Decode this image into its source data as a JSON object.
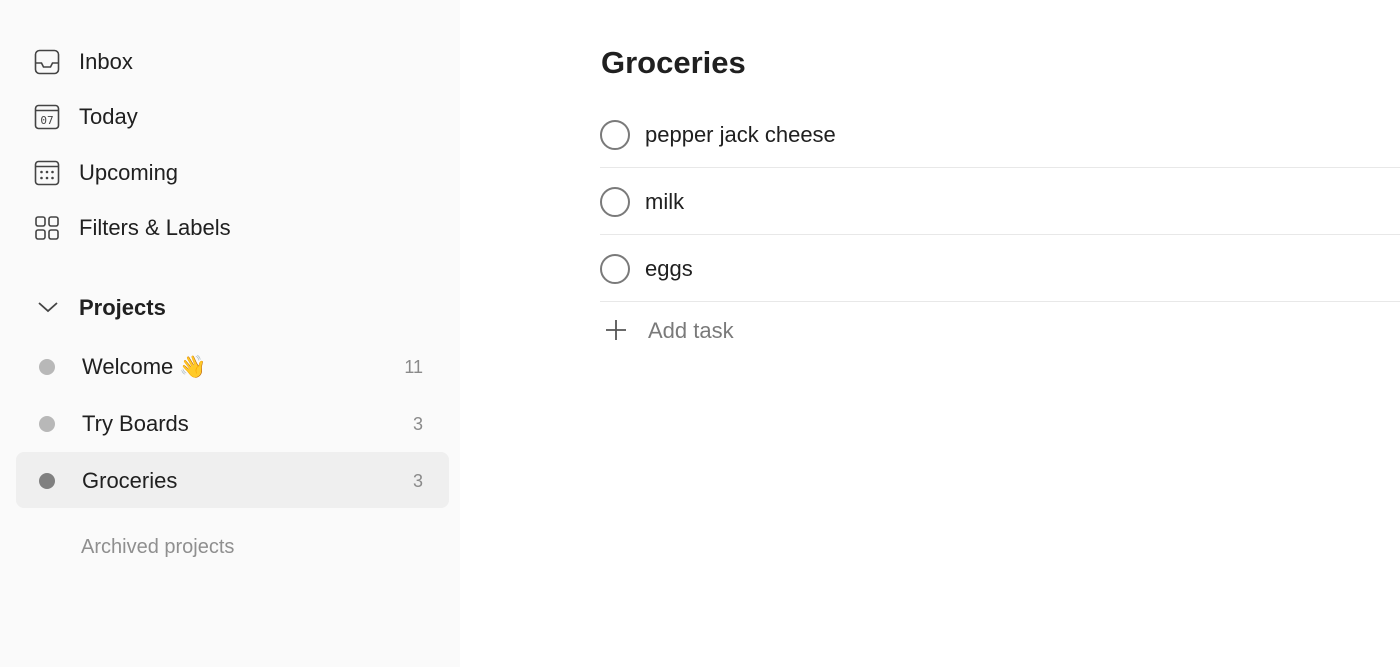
{
  "sidebar": {
    "nav": [
      {
        "label": "Inbox",
        "icon": "inbox-icon"
      },
      {
        "label": "Today",
        "icon": "calendar-today-icon",
        "day": "07"
      },
      {
        "label": "Upcoming",
        "icon": "calendar-upcoming-icon"
      },
      {
        "label": "Filters & Labels",
        "icon": "filters-grid-icon"
      }
    ],
    "projects_label": "Projects",
    "projects": [
      {
        "name": "Welcome 👋",
        "count": "11",
        "color": "#b8b8b8"
      },
      {
        "name": "Try Boards",
        "count": "3",
        "color": "#b8b8b8"
      },
      {
        "name": "Groceries",
        "count": "3",
        "color": "#808080"
      }
    ],
    "archived_label": "Archived projects"
  },
  "main": {
    "title": "Groceries",
    "tasks": [
      "pepper jack cheese",
      "milk",
      "eggs"
    ],
    "add_task_label": "Add task"
  }
}
